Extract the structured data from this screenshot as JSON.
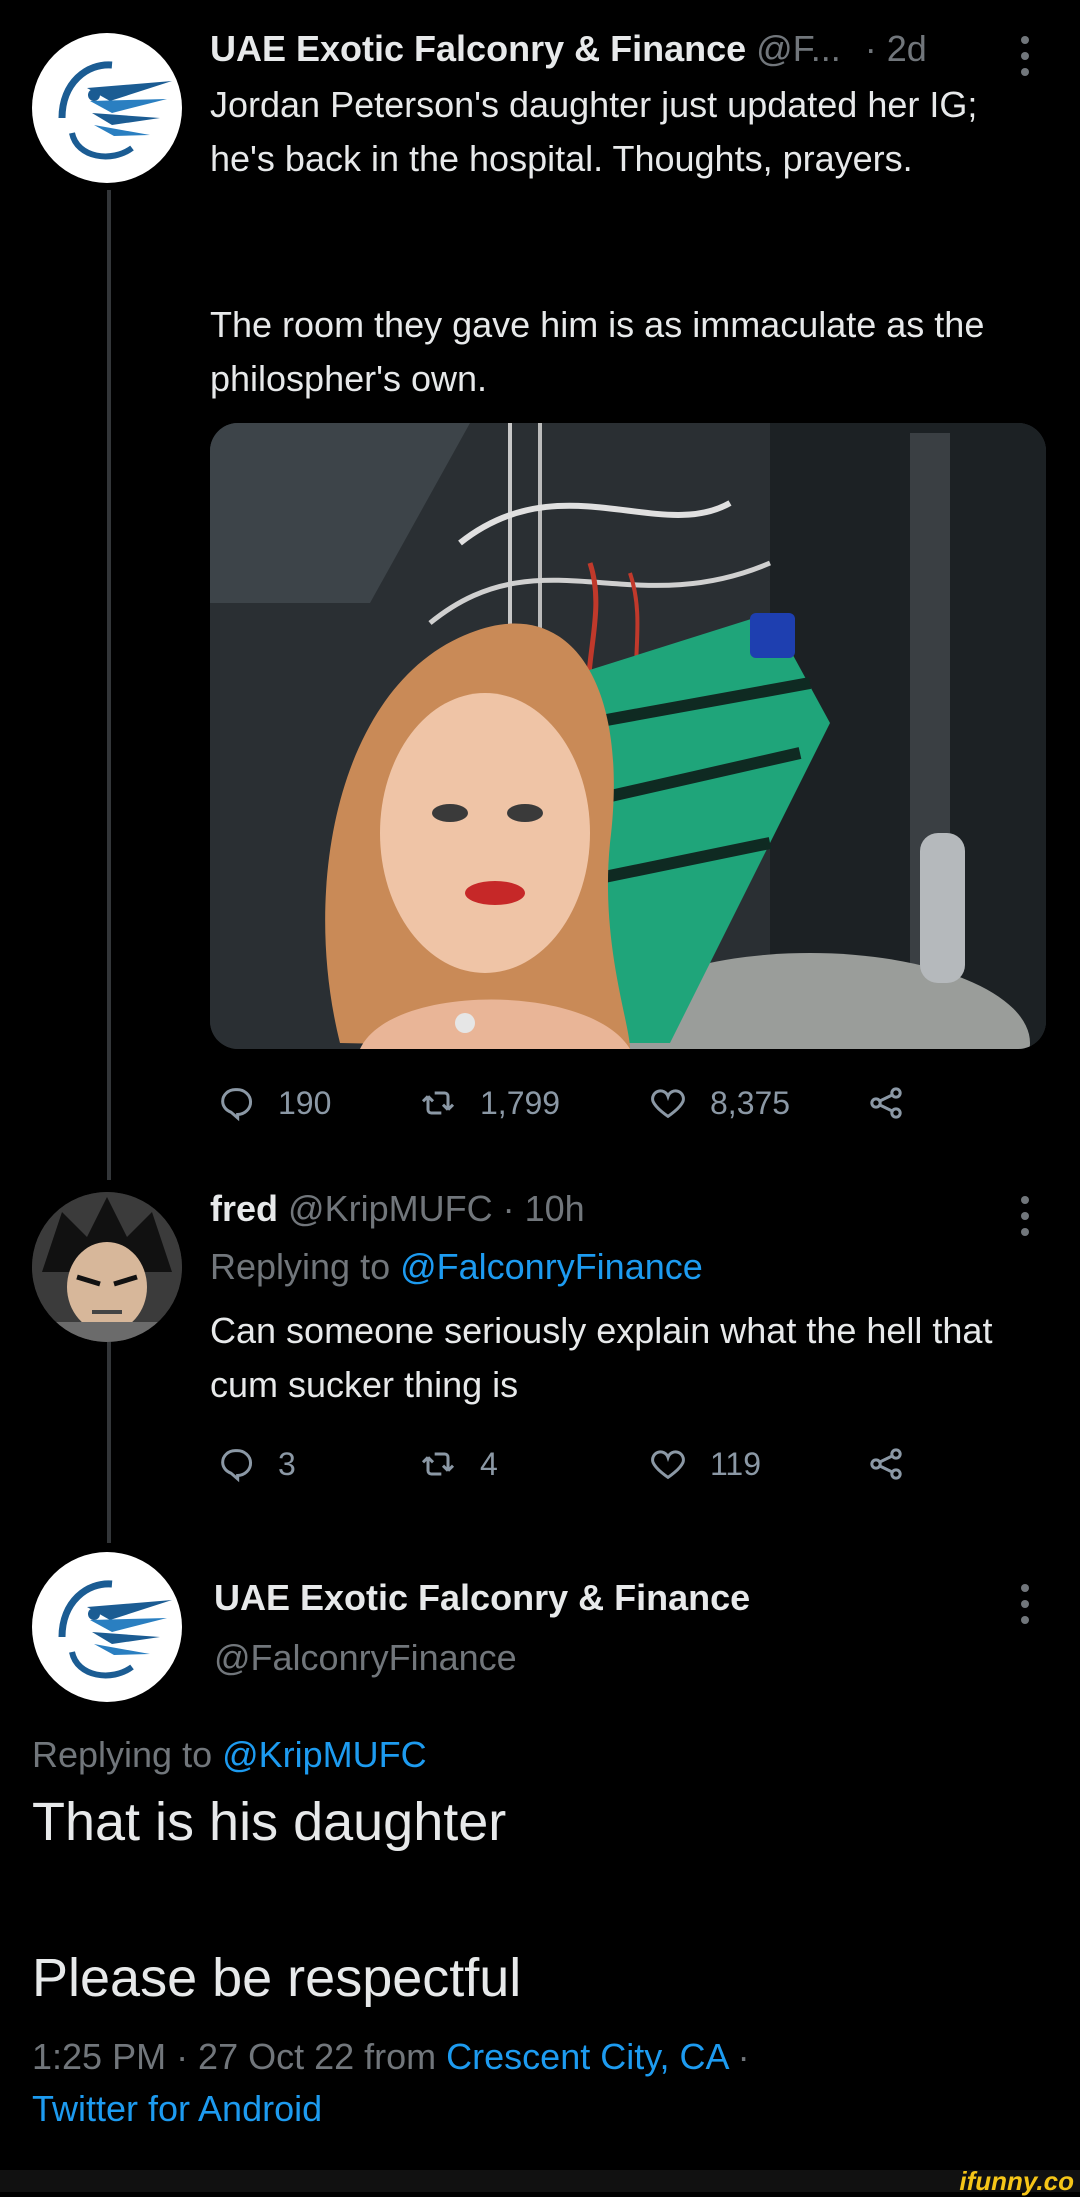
{
  "tweet1": {
    "display_name": "UAE Exotic Falconry & Finance",
    "handle": "@F...",
    "time": "· 2d",
    "text_para1": "Jordan Peterson's daughter just updated her IG; he's back in the hospital. Thoughts, prayers.",
    "text_para2": "The room they gave him is as immaculate as the philospher's own.",
    "replies": "190",
    "retweets": "1,799",
    "likes": "8,375"
  },
  "tweet2": {
    "display_name": "fred",
    "handle": "@KripMUFC · 10h",
    "replying_prefix": "Replying to ",
    "replying_handle": "@FalconryFinance",
    "text": "Can someone seriously explain what the hell that cum sucker thing is",
    "replies": "3",
    "retweets": "4",
    "likes": "119"
  },
  "tweet3": {
    "display_name": "UAE Exotic Falconry & Finance",
    "handle": "@FalconryFinance",
    "replying_prefix": "Replying to ",
    "replying_handle": "@KripMUFC",
    "text_line1": "That is his daughter",
    "text_line2": "Please be respectful",
    "timestamp": "1:25 PM · 27 Oct 22 from ",
    "location": "Crescent City, CA",
    "separator": " ·",
    "client": "Twitter for Android"
  },
  "watermark": "ifunny.co",
  "icons": {
    "reply": "reply-icon",
    "retweet": "retweet-icon",
    "like": "heart-icon",
    "share": "share-icon",
    "more": "more-dots-icon"
  },
  "colors": {
    "background": "#000000",
    "text": "#e7e9ea",
    "muted": "#71767b",
    "link": "#1d9bf0",
    "falcon_blue": "#1b5c93"
  }
}
